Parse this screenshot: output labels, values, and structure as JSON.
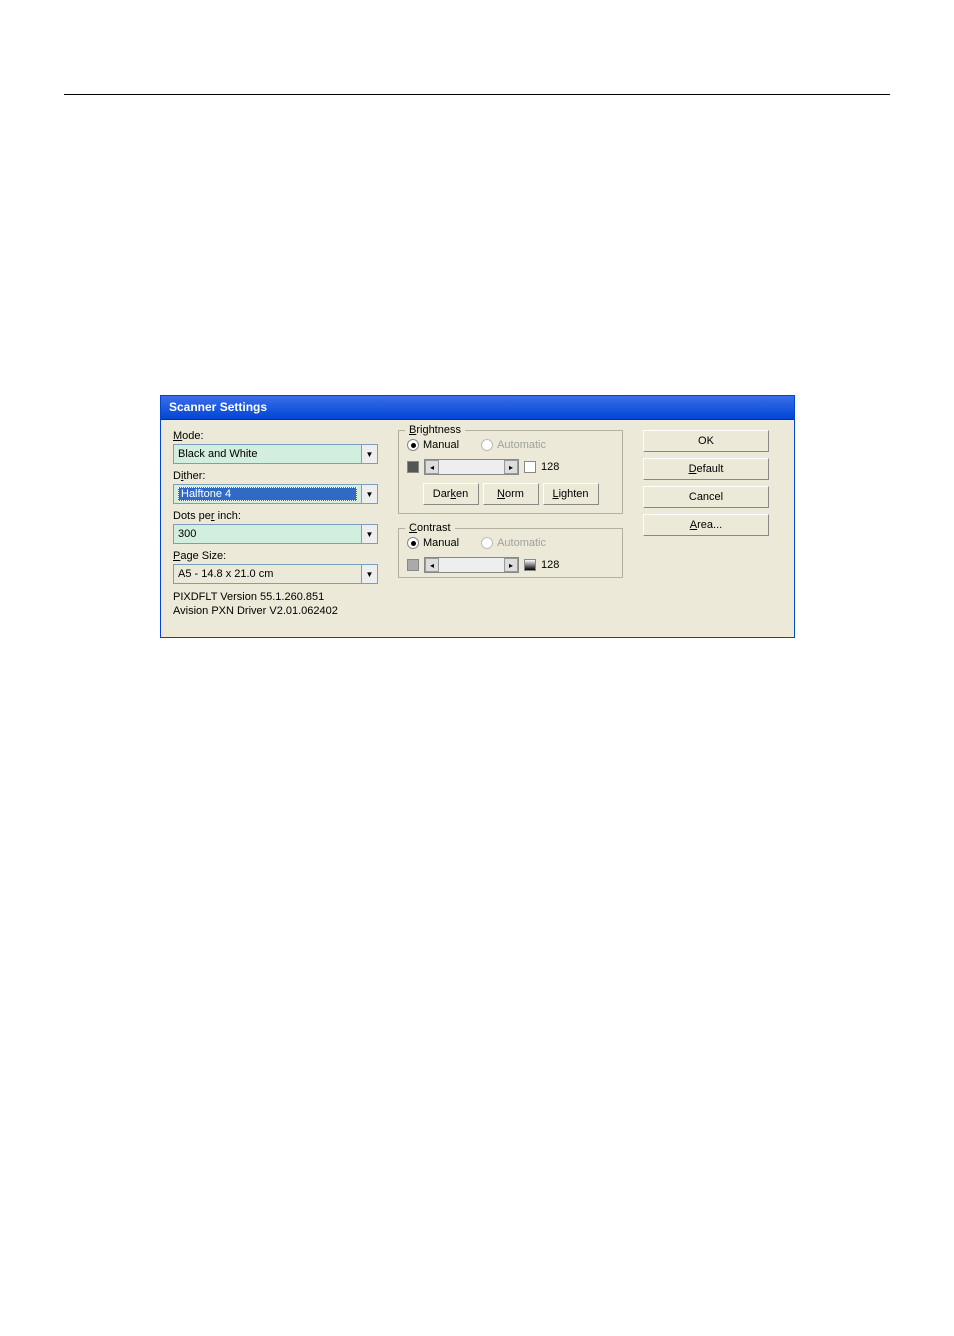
{
  "title": "Scanner Settings",
  "left": {
    "mode_label": "Mode:",
    "mode_value": "Black and White",
    "dither_label": "Dither:",
    "dither_value": "Halftone 4",
    "dpi_label": "Dots per inch:",
    "dpi_value": "300",
    "pagesize_label": "Page Size:",
    "pagesize_value": "A5 - 14.8 x 21.0 cm",
    "version1": "PIXDFLT Version 55.1.260.851",
    "version2": "Avision PXN Driver V2.01.062402"
  },
  "brightness": {
    "legend": "Brightness",
    "manual": "Manual",
    "automatic": "Automatic",
    "value": "128",
    "darken": "Darken",
    "norm": "Norm",
    "lighten": "Lighten"
  },
  "contrast": {
    "legend": "Contrast",
    "manual": "Manual",
    "automatic": "Automatic",
    "value": "128"
  },
  "buttons": {
    "ok": "OK",
    "default": "Default",
    "cancel": "Cancel",
    "area": "Area..."
  },
  "accel": {
    "M": "M",
    "i": "i",
    "r": "r",
    "P": "P",
    "B": "B",
    "C": "C",
    "k": "k",
    "N": "N",
    "L": "L",
    "D": "D",
    "A": "A"
  }
}
